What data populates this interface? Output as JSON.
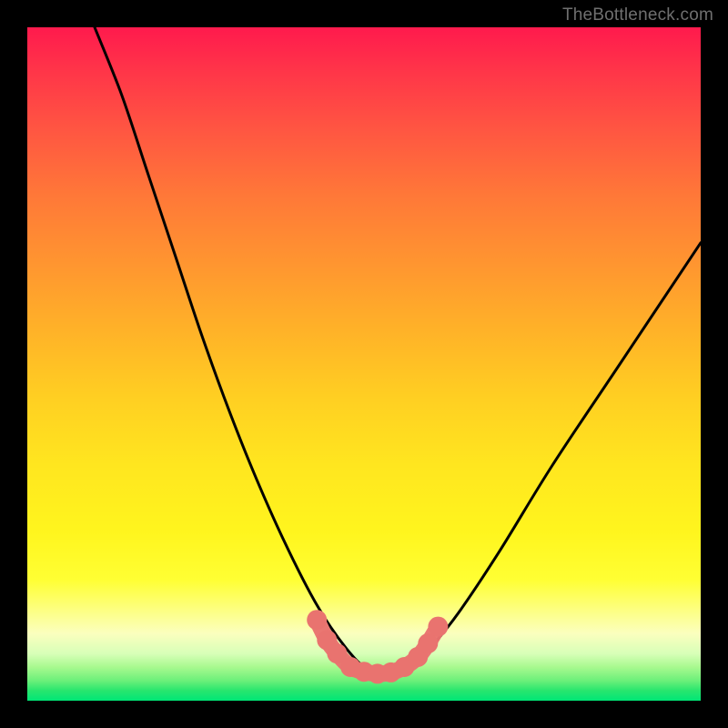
{
  "watermark": {
    "text": "TheBottleneck.com"
  },
  "chart_data": {
    "type": "line",
    "title": "",
    "xlabel": "",
    "ylabel": "",
    "xlim": [
      0,
      100
    ],
    "ylim": [
      0,
      100
    ],
    "grid": false,
    "legend": false,
    "series": [
      {
        "name": "bottleneck-curve",
        "x": [
          10,
          14,
          18,
          22,
          26,
          30,
          34,
          38,
          42,
          45,
          48,
          50,
          52,
          54,
          56,
          58,
          60,
          64,
          70,
          78,
          88,
          100
        ],
        "values": [
          100,
          90,
          78,
          66,
          54,
          43,
          33,
          24,
          16,
          11,
          7,
          5,
          4,
          4.5,
          5,
          6,
          8,
          13,
          22,
          35,
          50,
          68
        ]
      }
    ],
    "markers": {
      "name": "fit-region",
      "color": "#e9736f",
      "points": [
        {
          "x": 43,
          "y": 12
        },
        {
          "x": 44.5,
          "y": 9
        },
        {
          "x": 46,
          "y": 7
        },
        {
          "x": 48,
          "y": 5
        },
        {
          "x": 50,
          "y": 4.3
        },
        {
          "x": 52,
          "y": 4
        },
        {
          "x": 54,
          "y": 4.2
        },
        {
          "x": 56,
          "y": 5
        },
        {
          "x": 58,
          "y": 6.5
        },
        {
          "x": 59.5,
          "y": 8.5
        },
        {
          "x": 61,
          "y": 11
        }
      ]
    },
    "background_gradient": {
      "top": "#ff1a4d",
      "middle": "#ffe61f",
      "bottom": "#00e676"
    }
  }
}
